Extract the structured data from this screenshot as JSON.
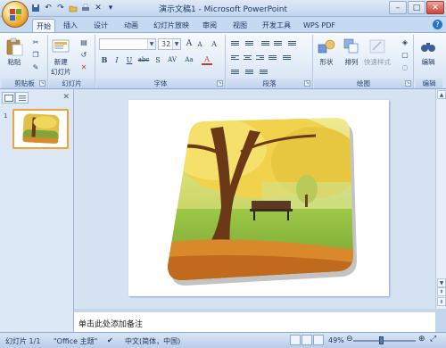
{
  "window": {
    "title": "演示文稿1 - Microsoft PowerPoint",
    "controls": [
      "–",
      "□",
      "✕"
    ]
  },
  "quick_access": [
    "save-icon",
    "undo-icon",
    "redo-icon",
    "open-icon",
    "print-icon",
    "close-icon",
    "customize-icon"
  ],
  "tabs": [
    {
      "label": "开始",
      "active": true
    },
    {
      "label": "插入"
    },
    {
      "label": "设计"
    },
    {
      "label": "动画"
    },
    {
      "label": "幻灯片放映"
    },
    {
      "label": "审阅"
    },
    {
      "label": "视图"
    },
    {
      "label": "开发工具"
    },
    {
      "label": "WPS PDF"
    }
  ],
  "ribbon": {
    "clipboard": {
      "label": "剪贴板",
      "paste": "粘贴"
    },
    "slides": {
      "label": "幻灯片",
      "new_slide_line1": "新建",
      "new_slide_line2": "幻灯片"
    },
    "font": {
      "label": "字体",
      "font_name": "",
      "font_size": "32",
      "grow": "A",
      "shrink": "A",
      "clear": "A",
      "bold": "B",
      "italic": "I",
      "underline": "U",
      "strike": "abc",
      "shadow": "S",
      "spacing": "AV",
      "case": "Aa",
      "color": "A"
    },
    "paragraph": {
      "label": "段落"
    },
    "drawing": {
      "label": "绘图",
      "shapes": "形状",
      "arrange": "排列",
      "quick_styles": "快速样式"
    },
    "editing": {
      "label": "编辑",
      "edit": "编辑"
    }
  },
  "slide_panel": {
    "slide_number": "1"
  },
  "notes": {
    "placeholder": "单击此处添加备注"
  },
  "status": {
    "slide_info": "幻灯片 1/1",
    "theme": "\"Office 主题\"",
    "language": "中文(简体，中国)",
    "zoom": "49%"
  }
}
